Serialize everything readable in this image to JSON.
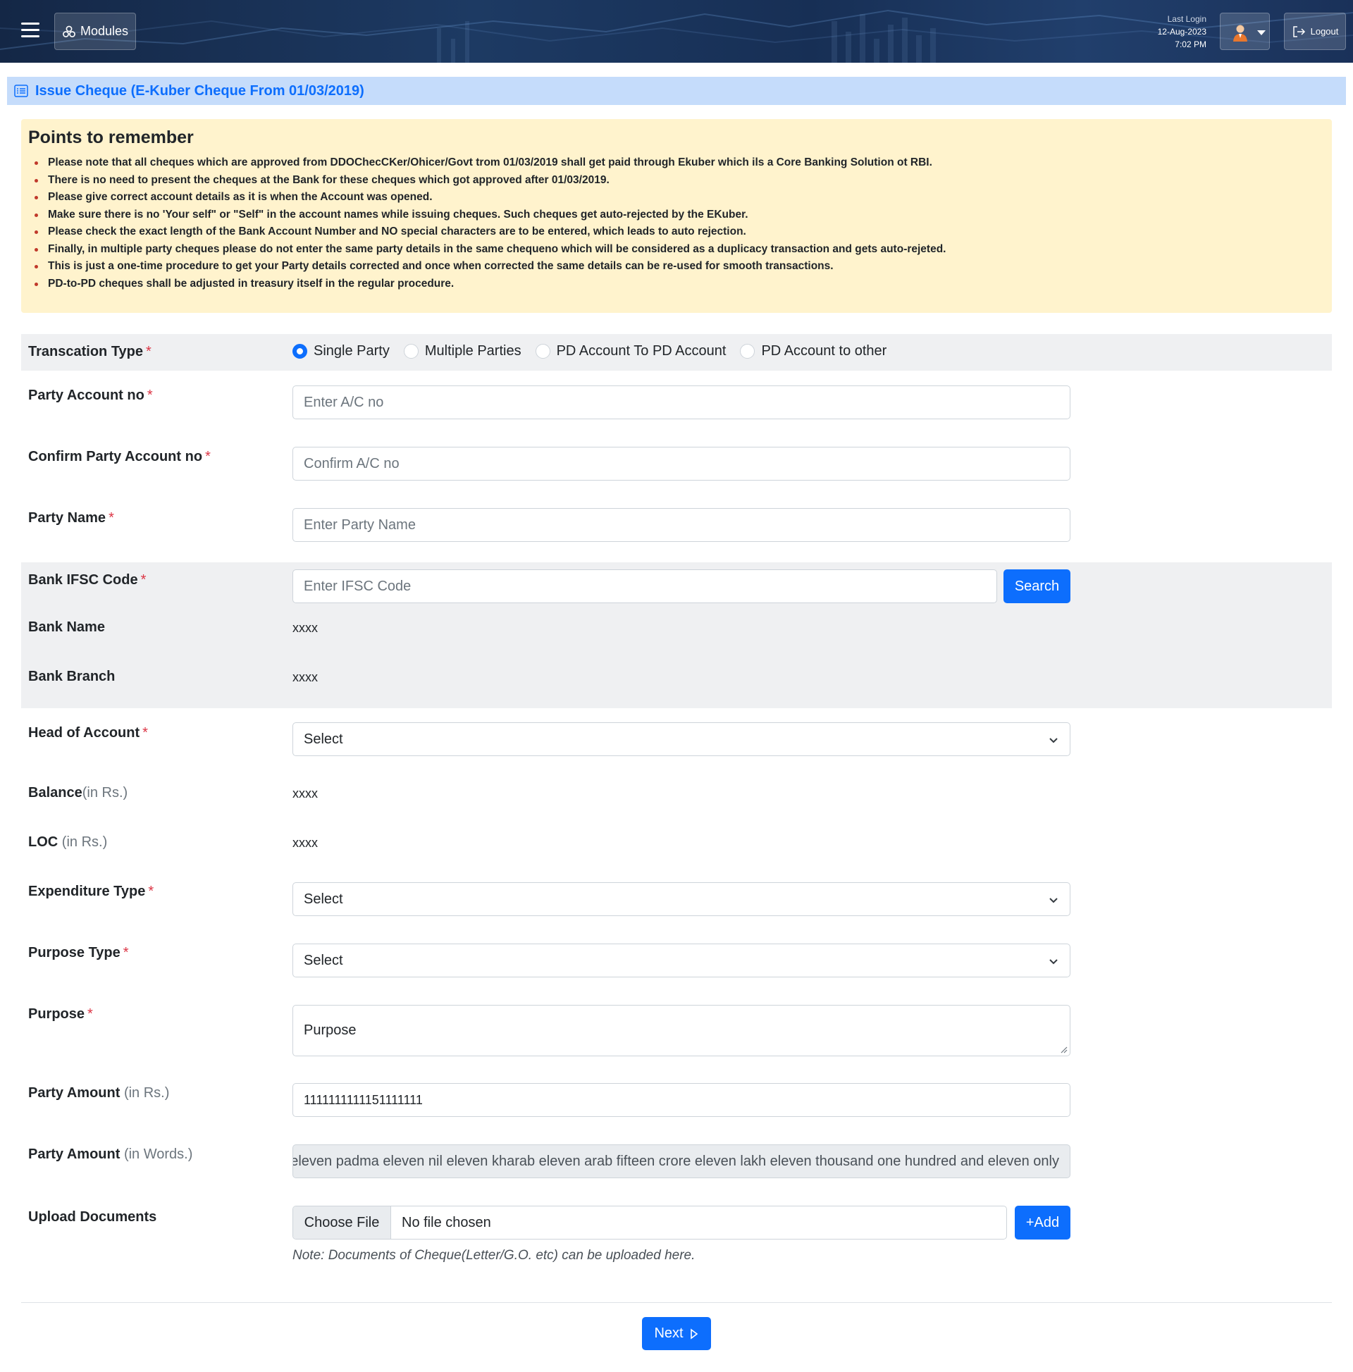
{
  "header": {
    "modules_label": "Modules",
    "last_login_title": "Last Login",
    "last_login_date": "12-Aug-2023",
    "last_login_time": "7:02 PM",
    "logout_label": "Logout"
  },
  "page": {
    "title": "Issue Cheque (E-Kuber Cheque From 01/03/2019)"
  },
  "notice": {
    "heading": "Points to remember",
    "items": [
      "Please note that all cheques which are approved from DDOChecCKer/Ohicer/Govt trom 01/03/2019 shall get paid through Ekuber which ils a Core Banking Solution ot RBI.",
      "There is no need to present the cheques at the Bank for these cheques which got approved after 01/03/2019.",
      "Please give correct account details as it is when the Account was opened.",
      "Make sure there is no 'Your self\" or \"Self\" in the account names while issuing cheques. Such cheques get auto-rejected by the EKuber.",
      "Please check the exact length of the Bank Account Number and NO special characters are to be entered, which leads to auto rejection.",
      "Finally, in multiple party cheques please do not enter the same party details in the same chequeno which will be considered as a duplicacy transaction and gets auto-rejeted.",
      "This is just a one-time procedure to get your Party details corrected and once when corrected the same details can be re-used for smooth transactions.",
      "PD-to-PD cheques shall be adjusted in treasury itself in the regular procedure."
    ]
  },
  "form": {
    "required_mark": "*",
    "transaction_type": {
      "label": "Transcation Type",
      "options": [
        "Single Party",
        "Multiple Parties",
        "PD Account To PD Account",
        "PD Account to other"
      ],
      "selected": "Single Party"
    },
    "party_account": {
      "label": "Party Account no",
      "placeholder": "Enter A/C no"
    },
    "confirm_account": {
      "label": "Confirm Party Account no",
      "placeholder": "Confirm A/C no"
    },
    "party_name": {
      "label": "Party Name",
      "placeholder": "Enter Party Name"
    },
    "ifsc": {
      "label": "Bank IFSC Code",
      "placeholder": "Enter IFSC Code",
      "search_label": "Search"
    },
    "bank_name": {
      "label": "Bank Name",
      "value": "xxxx"
    },
    "bank_branch": {
      "label": "Bank Branch",
      "value": "xxxx"
    },
    "head_of_account": {
      "label": "Head of Account",
      "value": "Select"
    },
    "balance": {
      "label": "Balance",
      "unit": "(in Rs.)",
      "value": "xxxx"
    },
    "loc": {
      "label": "LOC",
      "unit": "(in Rs.)",
      "value": "xxxx"
    },
    "expenditure_type": {
      "label": "Expenditure Type",
      "value": "Select"
    },
    "purpose_type": {
      "label": "Purpose Type",
      "value": "Select"
    },
    "purpose": {
      "label": "Purpose",
      "placeholder": "Purpose"
    },
    "party_amount": {
      "label": "Party Amount",
      "unit": "(in Rs.)",
      "value": "1111111111151111111"
    },
    "party_amount_words": {
      "label": "Party Amount",
      "unit": "(in Words.)",
      "value": "eleven padma eleven nil eleven kharab eleven arab fifteen crore eleven lakh eleven thousand one hundred and eleven only"
    },
    "upload": {
      "label": "Upload Documents",
      "choose_label": "Choose File",
      "file_status": "No file chosen",
      "add_label": "+Add",
      "note": "Note: Documents of Cheque(Letter/G.O. etc) can be uploaded here."
    },
    "next_label": "Next"
  },
  "colors": {
    "primary": "#0d6efd",
    "title_bar": "#c5dcfb",
    "notice_bg": "#fff3cd",
    "required": "#dc3545"
  }
}
